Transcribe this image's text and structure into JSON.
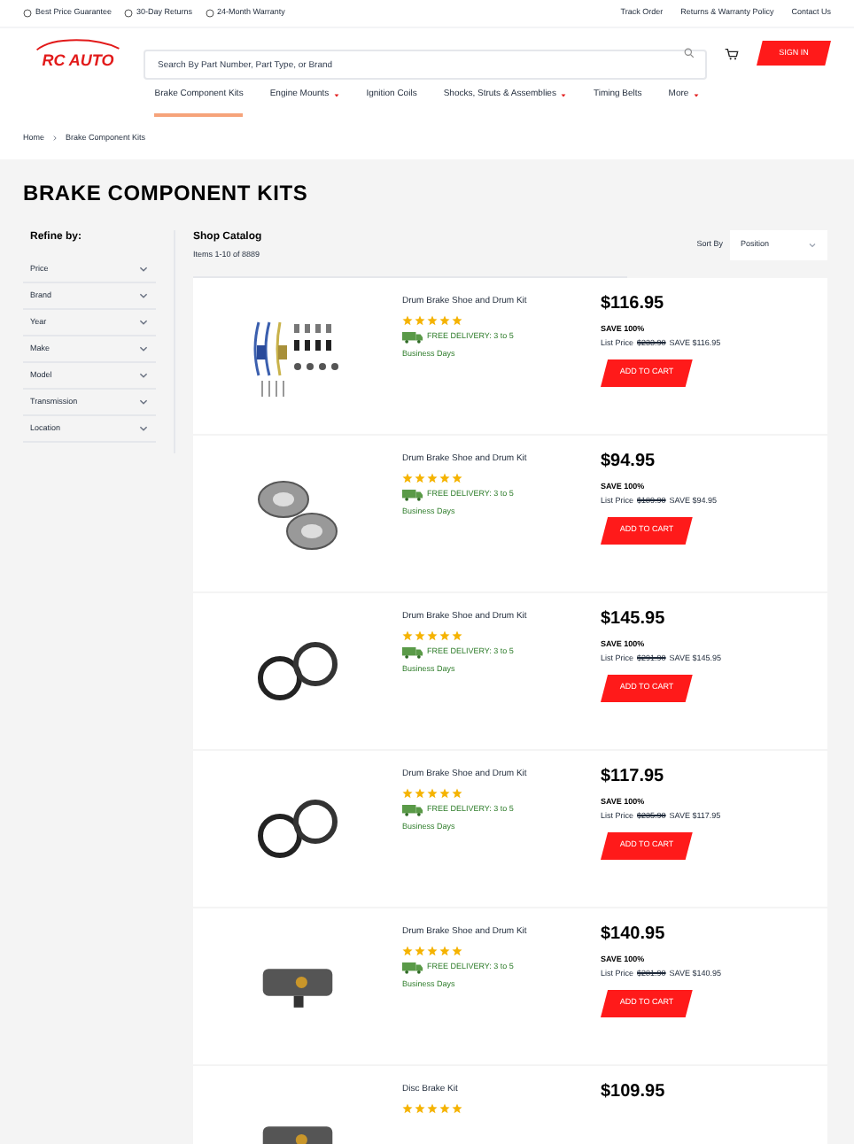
{
  "top_bar": {
    "perks": [
      "Best Price Guarantee",
      "30-Day Returns",
      "24-Month Warranty"
    ],
    "links": [
      "Track Order",
      "Returns & Warranty Policy",
      "Contact Us"
    ]
  },
  "header": {
    "logo": "RC AUTO",
    "search": {
      "placeholder": "Search By Part Number, Part Type, or Brand"
    },
    "sign_in": "SIGN IN"
  },
  "nav": [
    {
      "label": "Brake Component Kits",
      "selected": true,
      "has_menu": false
    },
    {
      "label": "Engine Mounts",
      "selected": false,
      "has_menu": true
    },
    {
      "label": "Ignition Coils",
      "selected": false,
      "has_menu": false
    },
    {
      "label": "Shocks, Struts & Assemblies",
      "selected": false,
      "has_menu": true
    },
    {
      "label": "Timing Belts",
      "selected": false,
      "has_menu": false
    },
    {
      "label": "More",
      "selected": false,
      "has_menu": true
    }
  ],
  "breadcrumb": [
    "Home",
    "Brake Component Kits"
  ],
  "page_title": "BRAKE COMPONENT KITS",
  "sidebar": {
    "title": "Refine by:",
    "filters": [
      "Price",
      "Brand",
      "Year",
      "Make",
      "Model",
      "Transmission",
      "Location"
    ]
  },
  "catalog": {
    "title": "Shop Catalog",
    "count": "Items 1-10 of 8889",
    "sort_label": "Sort By",
    "sort_value": "Position"
  },
  "products": [
    {
      "kind": "springs",
      "name": "Drum Brake Shoe and Drum Kit",
      "stars": 5,
      "delivery": "FREE DELIVERY: 3 to 5",
      "delivery_days": "Business Days",
      "price": "$116.95",
      "save": "SAVE 100%",
      "list_label": "List Price",
      "list_price": "$233.90",
      "save_amount": "SAVE $116.95",
      "button": "ADD TO CART"
    },
    {
      "kind": "drums",
      "name": "Drum Brake Shoe and Drum Kit",
      "stars": 5,
      "delivery": "FREE DELIVERY: 3 to 5",
      "delivery_days": "Business Days",
      "price": "$94.95",
      "save": "SAVE 100%",
      "list_label": "List Price",
      "list_price": "$189.90",
      "save_amount": "SAVE $94.95",
      "button": "ADD TO CART"
    },
    {
      "kind": "shoes",
      "name": "Drum Brake Shoe and Drum Kit",
      "stars": 5,
      "delivery": "FREE DELIVERY: 3 to 5",
      "delivery_days": "Business Days",
      "price": "$145.95",
      "save": "SAVE 100%",
      "list_label": "List Price",
      "list_price": "$291.90",
      "save_amount": "SAVE $145.95",
      "button": "ADD TO CART"
    },
    {
      "kind": "shoes",
      "name": "Drum Brake Shoe and Drum Kit",
      "stars": 5,
      "delivery": "FREE DELIVERY: 3 to 5",
      "delivery_days": "Business Days",
      "price": "$117.95",
      "save": "SAVE 100%",
      "list_label": "List Price",
      "list_price": "$235.90",
      "save_amount": "SAVE $117.95",
      "button": "ADD TO CART"
    },
    {
      "kind": "cylinder",
      "name": "Drum Brake Shoe and Drum Kit",
      "stars": 5,
      "delivery": "FREE DELIVERY: 3 to 5",
      "delivery_days": "Business Days",
      "price": "$140.95",
      "save": "SAVE 100%",
      "list_label": "List Price",
      "list_price": "$281.90",
      "save_amount": "SAVE $140.95",
      "button": "ADD TO CART"
    },
    {
      "kind": "cylinder",
      "name": "Disc Brake Kit",
      "stars": 5,
      "price": "$109.95"
    }
  ]
}
